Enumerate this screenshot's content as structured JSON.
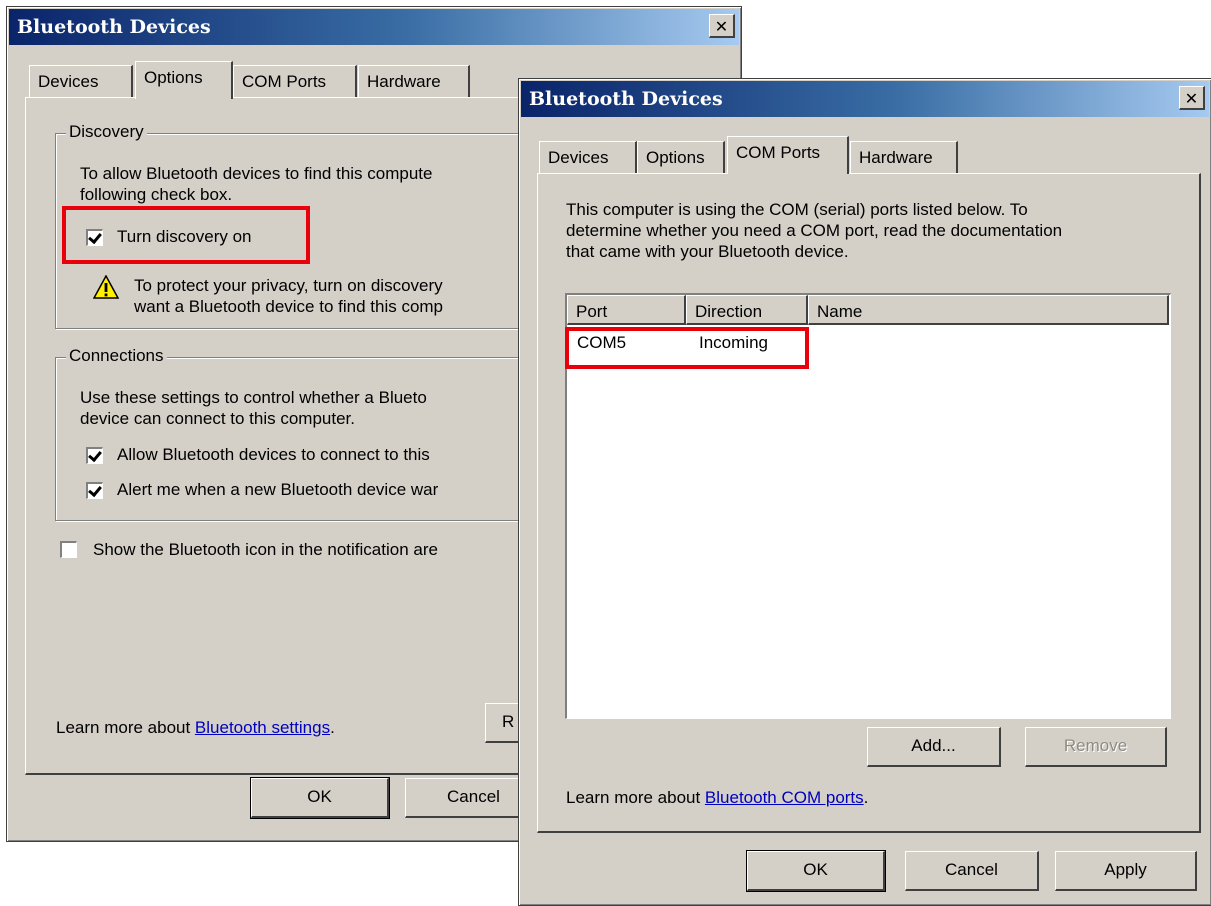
{
  "back_window": {
    "title": "Bluetooth Devices",
    "close_glyph": "✕",
    "tabs": [
      "Devices",
      "Options",
      "COM Ports",
      "Hardware"
    ],
    "active_tab": "Options",
    "discovery": {
      "group_label": "Discovery",
      "text_line1": "To allow Bluetooth devices to find this compute",
      "text_line2": "following check box.",
      "checkbox_label": "Turn discovery on",
      "checked": true,
      "warning_line1": "To protect your privacy, turn on discovery",
      "warning_line2": "want a Bluetooth device to find this comp"
    },
    "connections": {
      "group_label": "Connections",
      "text_line1": "Use these settings to control whether a Blueto",
      "text_line2": "device can connect to this computer.",
      "allow_label": "Allow Bluetooth devices to connect to this",
      "allow_checked": true,
      "alert_label": "Alert me when a new Bluetooth device war",
      "alert_checked": true
    },
    "show_icon_label": "Show the Bluetooth icon in the notification are",
    "show_icon_checked": false,
    "learn_prefix": "Learn more about ",
    "learn_link": "Bluetooth settings",
    "learn_suffix": ".",
    "restore_button_partial": "R",
    "ok_label": "OK",
    "cancel_label": "Cancel"
  },
  "front_window": {
    "title": "Bluetooth Devices",
    "close_glyph": "✕",
    "tabs": [
      "Devices",
      "Options",
      "COM Ports",
      "Hardware"
    ],
    "active_tab": "COM Ports",
    "description_line1": "This computer is using the COM (serial) ports listed below. To",
    "description_line2": "determine whether you need a COM port, read the documentation",
    "description_line3": "that came with your Bluetooth device.",
    "columns": [
      "Port",
      "Direction",
      "Name"
    ],
    "rows": [
      {
        "port": "COM5",
        "direction": "Incoming",
        "name": ""
      }
    ],
    "add_label": "Add...",
    "remove_label": "Remove",
    "learn_prefix": "Learn more about ",
    "learn_link": "Bluetooth COM ports",
    "learn_suffix": ".",
    "ok_label": "OK",
    "cancel_label": "Cancel",
    "apply_label": "Apply"
  },
  "colors": {
    "title_gradient_start": "#0a246a",
    "title_gradient_end": "#a6caf0",
    "dialog_face": "#d4d0c8",
    "highlight_box": "#e8000b",
    "link": "#0000c0"
  }
}
